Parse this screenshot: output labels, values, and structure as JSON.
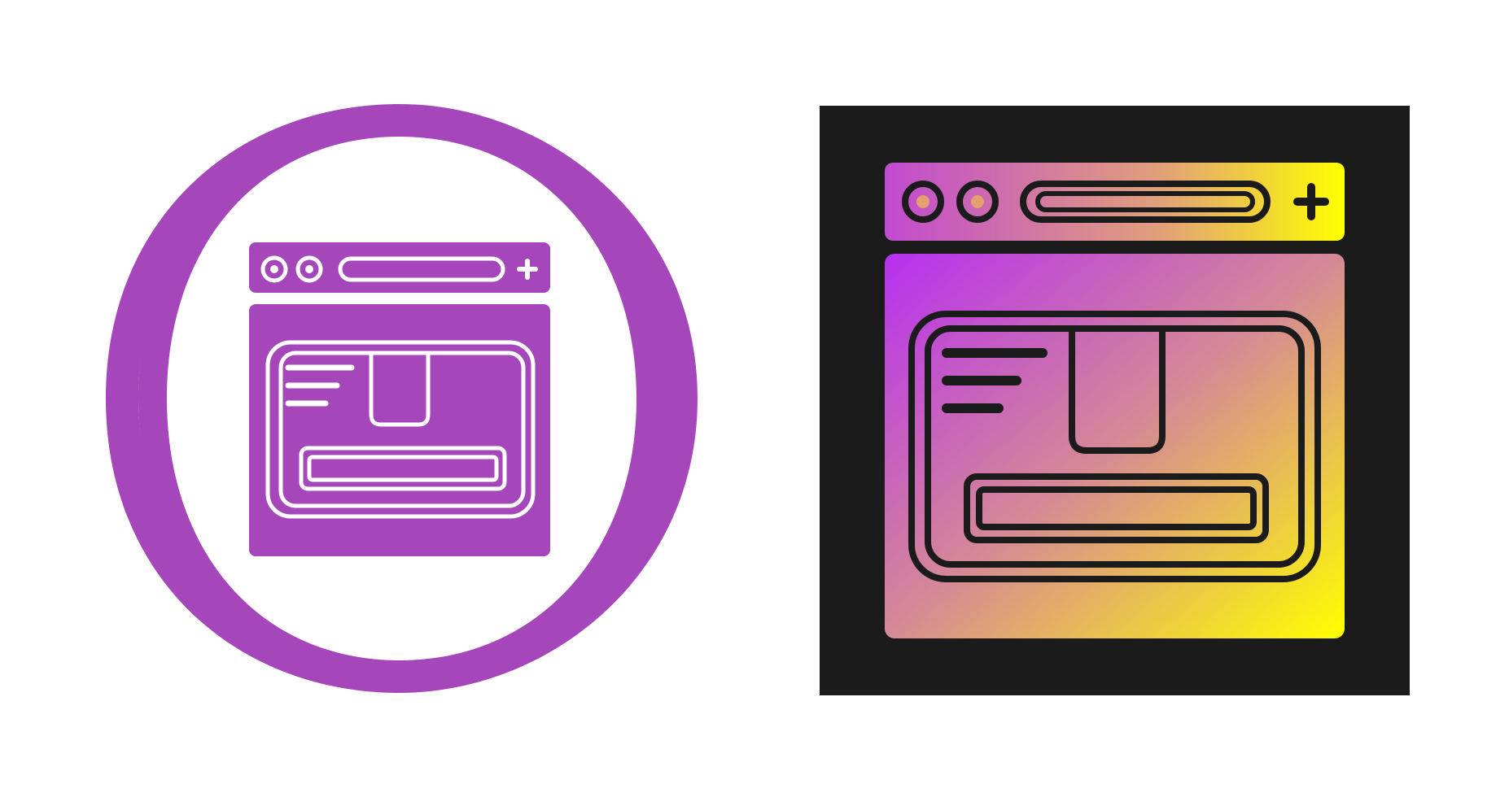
{
  "icons": [
    {
      "name": "web-browser-delivery-box-icon",
      "variant": "glyph-circle",
      "primary_color": "#a546bb",
      "secondary_color": "#ffffff"
    },
    {
      "name": "web-browser-delivery-box-icon",
      "variant": "gradient-square",
      "background_color": "#1b1b1b",
      "gradient_start": "#b630f0",
      "gradient_mid": "#d58a95",
      "gradient_end": "#ffff00",
      "stroke_color": "#1b1b1b"
    }
  ]
}
